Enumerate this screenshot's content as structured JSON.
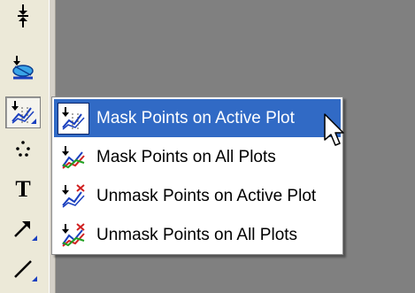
{
  "menu": {
    "items": [
      {
        "label": "Mask Points on Active Plot",
        "icon": "mask-points-active-icon",
        "selected": true
      },
      {
        "label": "Mask Points on All Plots",
        "icon": "mask-points-all-icon",
        "selected": false
      },
      {
        "label": "Unmask Points on Active Plot",
        "icon": "unmask-points-active-icon",
        "selected": false
      },
      {
        "label": "Unmask Points on All Plots",
        "icon": "unmask-points-all-icon",
        "selected": false
      }
    ]
  },
  "toolbar": {
    "text_tool_glyph": "T"
  },
  "colors": {
    "highlight": "#316ac5",
    "toolbar_bg": "#ece9d8",
    "workspace_bg": "#808080",
    "accent_blue": "#1a3fbf"
  }
}
